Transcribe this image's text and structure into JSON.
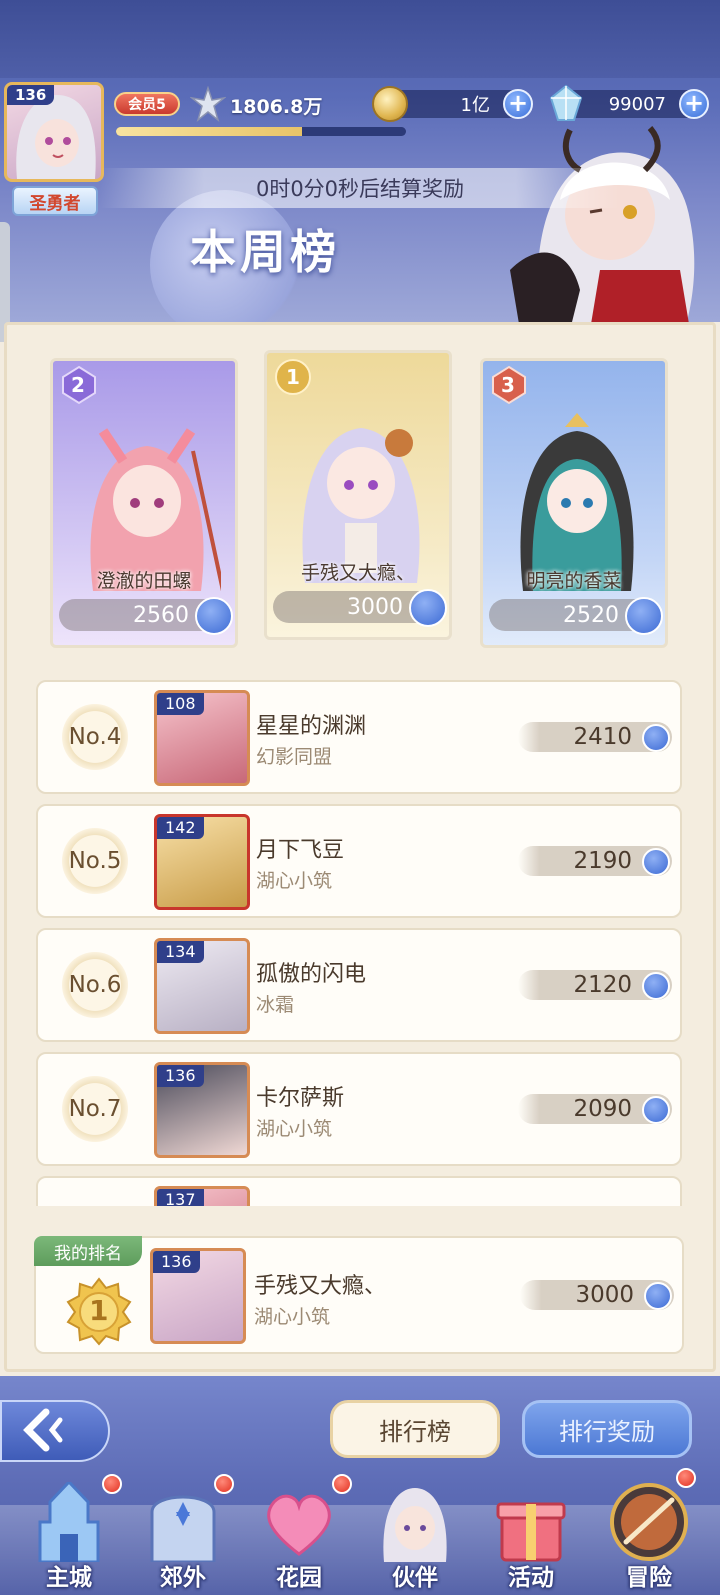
{
  "player": {
    "level": "136",
    "title": "圣勇者",
    "vip": "会员5",
    "power": "1806.8万",
    "exp_fraction": 0.64
  },
  "currency": {
    "gold": "1亿",
    "gems": "99007"
  },
  "timer": "0时0分0秒后结算奖励",
  "board_title": "本周榜",
  "podium": [
    {
      "rank": "2",
      "name": "澄澈的田螺",
      "score": "2560"
    },
    {
      "rank": "1",
      "name": "手残又大瘾、",
      "score": "3000"
    },
    {
      "rank": "3",
      "name": "明亮的香菜",
      "score": "2520"
    }
  ],
  "rows": [
    {
      "rank": "No.4",
      "level": "108",
      "name": "星星的渊渊",
      "guild": "幻影同盟",
      "score": "2410"
    },
    {
      "rank": "No.5",
      "level": "142",
      "name": "月下飞豆",
      "guild": "湖心小筑",
      "score": "2190"
    },
    {
      "rank": "No.6",
      "level": "134",
      "name": "孤傲的闪电",
      "guild": "冰霜",
      "score": "2120"
    },
    {
      "rank": "No.7",
      "level": "136",
      "name": "卡尔萨斯",
      "guild": "湖心小筑",
      "score": "2090"
    },
    {
      "rank": "",
      "level": "137",
      "name": "",
      "guild": "",
      "score": ""
    }
  ],
  "my_rank": {
    "label": "我的排名",
    "rank": "1",
    "level": "136",
    "name": "手残又大瘾、",
    "guild": "湖心小筑",
    "score": "3000"
  },
  "buttons": {
    "leaderboard": "排行榜",
    "rewards": "排行奖励"
  },
  "nav": [
    {
      "label": "主城",
      "icon": "castle-icon",
      "badge": true
    },
    {
      "label": "郊外",
      "icon": "gate-icon",
      "badge": true
    },
    {
      "label": "花园",
      "icon": "heart-icon",
      "badge": true
    },
    {
      "label": "伙伴",
      "icon": "companion-icon",
      "badge": false
    },
    {
      "label": "活动",
      "icon": "gift-icon",
      "badge": false
    },
    {
      "label": "冒险",
      "icon": "sword-icon",
      "badge": true
    }
  ],
  "colors": {
    "accent_blue": "#4c78d4",
    "gold": "#e7b85b",
    "panel": "#f4eddf",
    "badge_red": "#e23020"
  }
}
